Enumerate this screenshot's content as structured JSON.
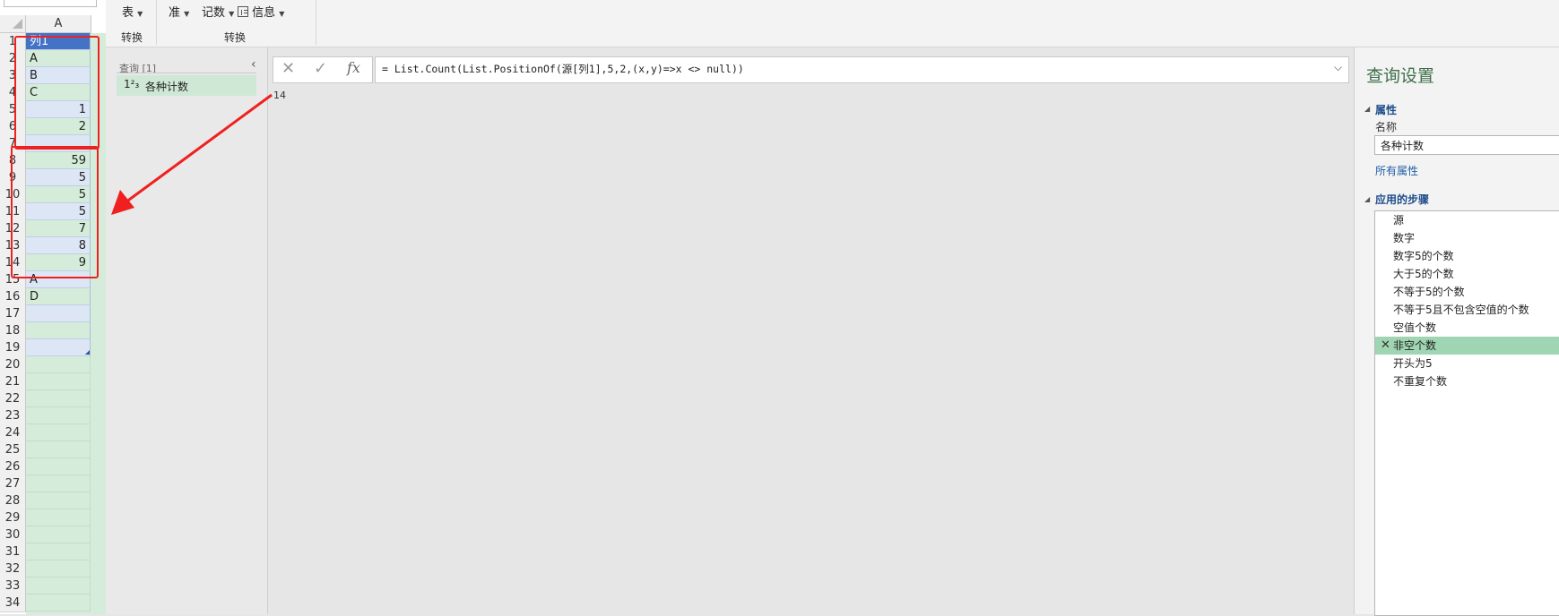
{
  "sheet": {
    "column_header": "A",
    "rows": [
      "1",
      "2",
      "3",
      "4",
      "5",
      "6",
      "7",
      "8",
      "9",
      "10",
      "11",
      "12",
      "13",
      "14",
      "15",
      "16",
      "17",
      "18",
      "19",
      "20",
      "21",
      "22",
      "23",
      "24",
      "25",
      "26",
      "27",
      "28",
      "29",
      "30",
      "31",
      "32",
      "33",
      "34"
    ],
    "cells": [
      {
        "row": "1",
        "value": "列1",
        "kind": "hdr"
      },
      {
        "row": "2",
        "value": "A",
        "kind": "green"
      },
      {
        "row": "3",
        "value": "B",
        "kind": "blue"
      },
      {
        "row": "4",
        "value": "C",
        "kind": "green"
      },
      {
        "row": "5",
        "value": "1",
        "kind": "blue",
        "num": true
      },
      {
        "row": "6",
        "value": "2",
        "kind": "green",
        "num": true
      },
      {
        "row": "7",
        "value": "",
        "kind": "blue"
      },
      {
        "row": "8",
        "value": "59",
        "kind": "green",
        "num": true
      },
      {
        "row": "9",
        "value": "5",
        "kind": "blue",
        "num": true
      },
      {
        "row": "10",
        "value": "5",
        "kind": "green",
        "num": true
      },
      {
        "row": "11",
        "value": "5",
        "kind": "blue",
        "num": true
      },
      {
        "row": "12",
        "value": "7",
        "kind": "green",
        "num": true
      },
      {
        "row": "13",
        "value": "8",
        "kind": "blue",
        "num": true
      },
      {
        "row": "14",
        "value": "9",
        "kind": "green",
        "num": true
      },
      {
        "row": "15",
        "value": "A",
        "kind": "blue"
      },
      {
        "row": "16",
        "value": "D",
        "kind": "green"
      },
      {
        "row": "17",
        "value": "",
        "kind": "blue"
      },
      {
        "row": "18",
        "value": "",
        "kind": "green"
      },
      {
        "row": "19",
        "value": "",
        "kind": "blue"
      }
    ]
  },
  "ribbon": {
    "cut_top_label": "表",
    "cut_top_label2": "准",
    "btn_count": "记数",
    "btn_info": "信息",
    "group1": "转换",
    "group2": "转换"
  },
  "queries": {
    "title": "查询 [1]",
    "item_icon": "1²₃",
    "item_name": "各种计数"
  },
  "formula_bar": {
    "cancel_icon": "✕",
    "confirm_icon": "✓",
    "fx_icon": "fx",
    "formula": "= List.Count(List.PositionOf(源[列1],5,2,(x,y)=>x <> null))",
    "result": "14"
  },
  "settings": {
    "title": "查询设置",
    "properties_header": "属性",
    "name_label": "名称",
    "name_value": "各种计数",
    "all_properties": "所有属性",
    "steps_header": "应用的步骤",
    "steps": [
      "源",
      "数字",
      "数字5的个数",
      "大于5的个数",
      "不等于5的个数",
      "不等于5且不包含空值的个数",
      "空值个数",
      "非空个数",
      "开头为5",
      "不重复个数"
    ],
    "selected_step_index": 7
  },
  "colors": {
    "accent_green": "#9fd5b2",
    "table_header_blue": "#4472c4",
    "annotation_red": "#f02020"
  }
}
